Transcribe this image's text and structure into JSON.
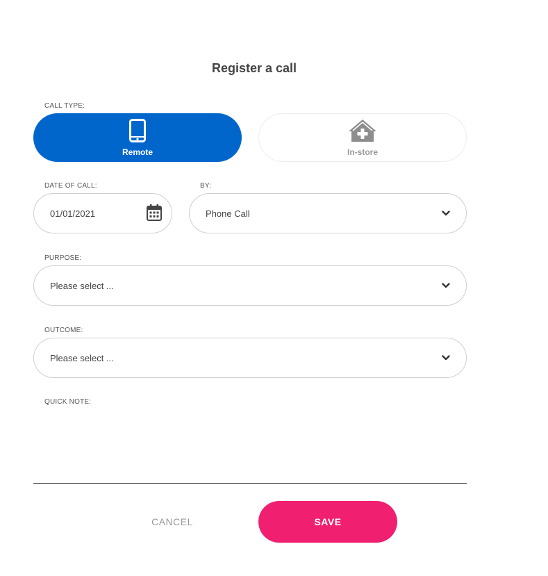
{
  "dialog": {
    "title": "Register a call"
  },
  "call_type": {
    "label": "CALL TYPE:",
    "options": [
      {
        "label": "Remote",
        "icon": "mobile-phone-icon",
        "selected": true
      },
      {
        "label": "In-store",
        "icon": "home-plus-icon",
        "selected": false
      }
    ]
  },
  "date_of_call": {
    "label": "DATE OF CALL:",
    "value": "01/01/2021",
    "icon": "calendar-icon"
  },
  "by": {
    "label": "BY:",
    "value": "Phone Call"
  },
  "purpose": {
    "label": "PURPOSE:",
    "placeholder": "Please select ..."
  },
  "outcome": {
    "label": "OUTCOME:",
    "placeholder": "Please select ..."
  },
  "quick_note": {
    "label": "QUICK NOTE:",
    "value": ""
  },
  "actions": {
    "cancel": "CANCEL",
    "save": "SAVE"
  },
  "colors": {
    "primary": "#0066cc",
    "accent": "#f01f70",
    "muted": "#9a9a9a"
  }
}
